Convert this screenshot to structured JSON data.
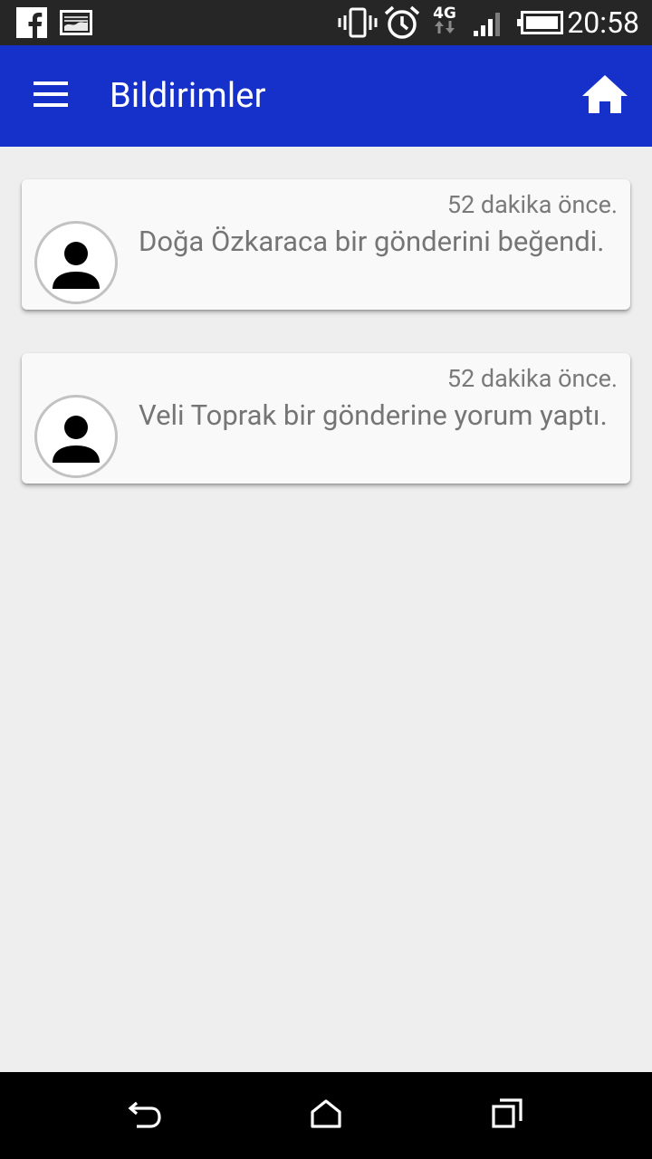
{
  "status_bar": {
    "time": "20:58",
    "network_type": "4G",
    "icons": [
      "facebook-icon",
      "image-notification-icon",
      "vibrate-icon",
      "alarm-icon",
      "network-4g-icon",
      "signal-icon",
      "battery-icon"
    ]
  },
  "app_bar": {
    "title": "Bildirimler",
    "background": "#1531c9",
    "left_icon": "menu-icon",
    "right_icon": "home-icon"
  },
  "notifications": [
    {
      "time": "52 dakika önce.",
      "message": "Doğa Özkaraca bir gönderini beğendi.",
      "avatar_icon": "person-icon"
    },
    {
      "time": "52 dakika önce.",
      "message": "Veli Toprak bir gönderine yorum yaptı.",
      "avatar_icon": "person-icon"
    }
  ],
  "nav_bar": {
    "icons": [
      "back-icon",
      "home-nav-icon",
      "recents-icon"
    ]
  }
}
